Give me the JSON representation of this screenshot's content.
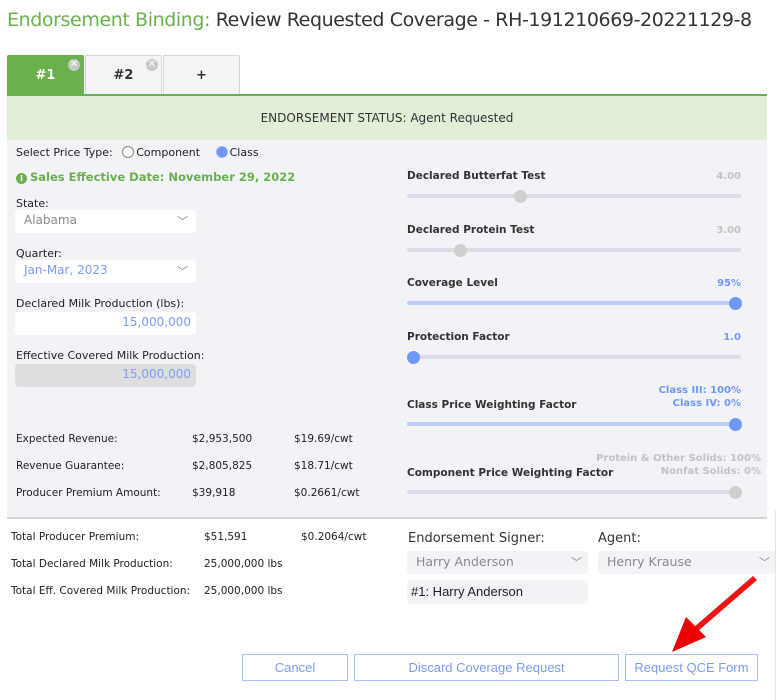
{
  "header": {
    "title_prefix": "Endorsement Binding:",
    "title_main": "Review Requested Coverage - RH-191210669-20221129-8"
  },
  "tabs": [
    {
      "label": "#1",
      "active": true,
      "closable": true
    },
    {
      "label": "#2",
      "active": false,
      "closable": true
    },
    {
      "label": "+",
      "active": false,
      "closable": false
    }
  ],
  "tab_close_glyph": "✕",
  "status_bar": "ENDORSEMENT STATUS: Agent Requested",
  "price_type": {
    "label": "Select Price Type:",
    "options": [
      {
        "label": "Component",
        "selected": false
      },
      {
        "label": "Class",
        "selected": true
      }
    ]
  },
  "sales_effective": {
    "icon": "info-icon",
    "icon_glyph": "i",
    "text": "Sales Effective Date: November 29, 2022"
  },
  "state": {
    "label": "State:",
    "value": "Alabama"
  },
  "quarter": {
    "label": "Quarter:",
    "value": "Jan-Mar, 2023"
  },
  "declared_milk": {
    "label": "Declared Milk Production (lbs):",
    "value": "15,000,000"
  },
  "effective_covered": {
    "label": "Effective Covered Milk Production:",
    "value": "15,000,000"
  },
  "chevron_glyph": "﹀",
  "summary_rows": [
    {
      "label": "Expected Revenue:",
      "amount": "$2,953,500",
      "per_cwt": "$19.69/cwt"
    },
    {
      "label": "Revenue Guarantee:",
      "amount": "$2,805,825",
      "per_cwt": "$18.71/cwt"
    },
    {
      "label": "Producer Premium Amount:",
      "amount": "$39,918",
      "per_cwt": "$0.2661/cwt"
    }
  ],
  "sliders": [
    {
      "title": "Declared Butterfat Test",
      "value_lines": [
        "4.00"
      ],
      "position": 0.34,
      "enabled": false
    },
    {
      "title": "Declared Protein Test",
      "value_lines": [
        "3.00"
      ],
      "position": 0.16,
      "enabled": false
    },
    {
      "title": "Coverage Level",
      "value_lines": [
        "95%"
      ],
      "position": 0.985,
      "enabled": true
    },
    {
      "title": "Protection Factor",
      "value_lines": [
        "1.0"
      ],
      "position": 0.02,
      "enabled": true
    },
    {
      "title": "Class Price Weighting Factor",
      "value_lines": [
        "Class III: 100%",
        "Class IV: 0%"
      ],
      "position": 0.985,
      "enabled": true
    },
    {
      "title": "Component Price Weighting Factor",
      "value_lines": [
        "Protein & Other Solids: 100%",
        "Nonfat Solids: 0%"
      ],
      "position": 0.985,
      "enabled": false
    }
  ],
  "totals": [
    {
      "label": "Total Producer Premium:",
      "amount": "$51,591",
      "per_cwt": "$0.2064/cwt"
    },
    {
      "label": "Total Declared Milk Production:",
      "amount": "25,000,000 lbs",
      "per_cwt": ""
    },
    {
      "label": "Total Eff. Covered Milk Production:",
      "amount": "25,000,000 lbs",
      "per_cwt": ""
    }
  ],
  "signer": {
    "label": "Endorsement Signer:",
    "value": "Harry Anderson",
    "list_entry": "#1: Harry Anderson"
  },
  "agent": {
    "label": "Agent:",
    "value": "Henry Krause"
  },
  "buttons": {
    "cancel": "Cancel",
    "discard": "Discard Coverage Request",
    "request_qce": "Request QCE Form"
  },
  "colors": {
    "brand_green": "#6ab04c",
    "status_bg": "#e1efd9",
    "accent_blue": "#6f97f5",
    "annotation_red": "#ff0000"
  }
}
